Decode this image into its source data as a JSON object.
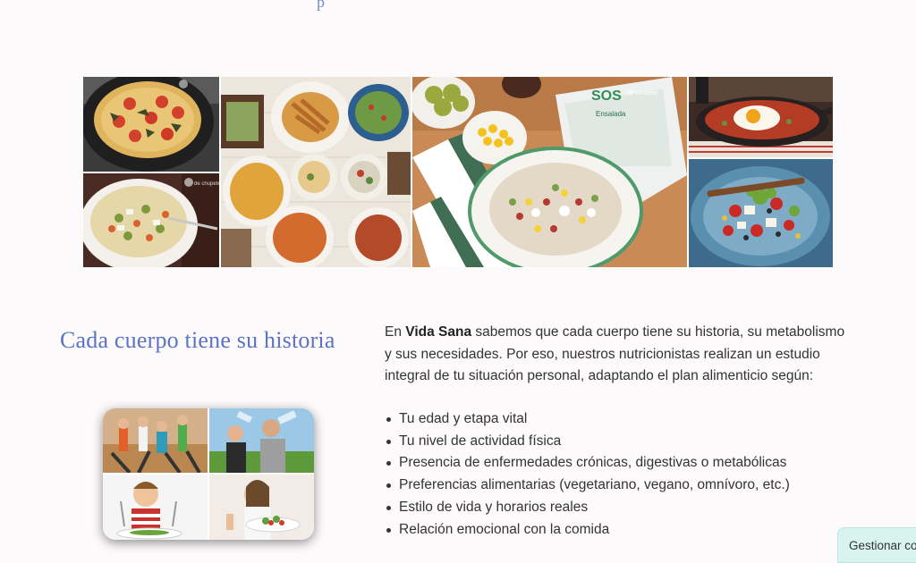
{
  "top_fragment": "p",
  "section": {
    "title": "Cada cuerpo tiene su historia",
    "intro_prefix": "En ",
    "brand": "Vida Sana",
    "intro_suffix": " sabemos que cada cuerpo tiene su historia, su metabolismo y sus necesidades. Por eso, nuestros nutricionistas realizan un estudio integral de tu situación personal, adaptando el plan alimenticio según:",
    "factors": [
      "Tu edad y etapa vital",
      "Tu nivel de actividad física",
      "Presencia de enfermedades crónicas, digestivas o metabólicas",
      "Preferencias alimentarias (vegetariano, vegano, omnívoro, etc.)",
      "Estilo de vida y horarios reales",
      "Relación emocional con la comida"
    ]
  },
  "collage": {
    "watermark": "de chupete",
    "package_brand": "SOS",
    "package_text": "Ensalada"
  },
  "consent": {
    "label": "Gestionar con"
  }
}
